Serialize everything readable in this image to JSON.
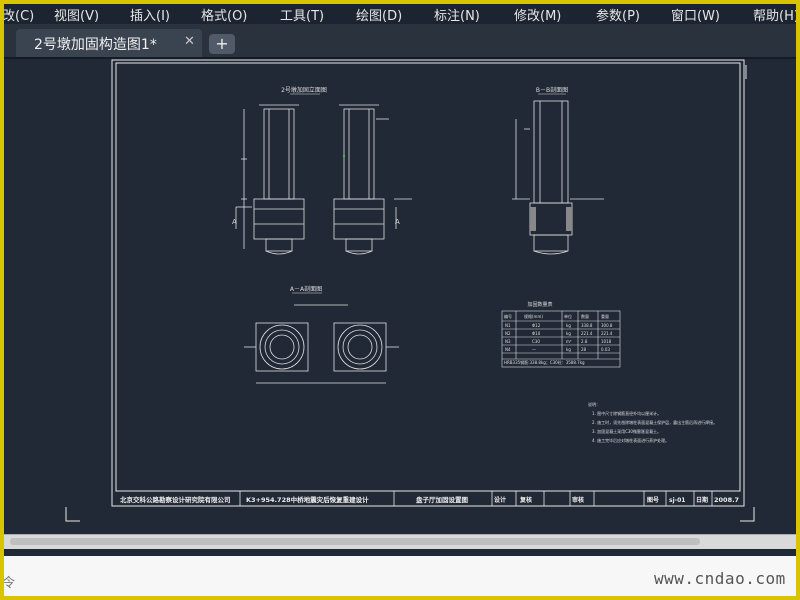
{
  "menu": [
    {
      "label": "改(C)"
    },
    {
      "label": "视图(V)"
    },
    {
      "label": "插入(I)"
    },
    {
      "label": "格式(O)"
    },
    {
      "label": "工具(T)"
    },
    {
      "label": "绘图(D)"
    },
    {
      "label": "标注(N)"
    },
    {
      "label": "修改(M)"
    },
    {
      "label": "参数(P)"
    },
    {
      "label": "窗口(W)"
    },
    {
      "label": "帮助(H)"
    }
  ],
  "tab": {
    "title": "2号墩加固构造图1*",
    "close": "✕",
    "add": "+"
  },
  "drawing": {
    "elevation_title": "2号墩加固立面图",
    "section_bb_title": "B－B剖面图",
    "section_aa_title": "A－A剖面图",
    "section_marker_a": "A",
    "section_marker_b": "B",
    "table_title": "加固数量表",
    "table_headers": [
      "编号",
      "规格(mm)",
      "单位",
      "数量",
      "重量"
    ],
    "table_rows": [
      [
        "N1",
        "Φ12",
        "kg",
        "338.8",
        "300.8"
      ],
      [
        "N2",
        "Φ10",
        "kg",
        "221.4",
        "221.4"
      ],
      [
        "N3",
        "C30",
        "m³",
        "2.8",
        "1018"
      ],
      [
        "N4",
        "—",
        "kg",
        "28",
        "0.03"
      ]
    ],
    "table_footer": "HRB335钢筋:338.8kg；C30砼：3588.7kg",
    "notes_title": "说明：",
    "notes": [
      "1. 图中尺寸除钢筋直径外均以厘米计。",
      "2. 施工时，须先凿除墩柱表面混凝土保护层，露出主筋后再进行焊接。",
      "3. 加固混凝土采用C30微膨胀混凝土。",
      "4. 施工完毕后应对墩柱表面进行养护处理。"
    ],
    "titleblock": {
      "company": "北京交科公路勘察设计研究院有限公司",
      "project": "K3+954.728中桥地震灾后恢复重建设计",
      "drawing_name": "盘子厅加固设置图",
      "design": "设计",
      "review": "复核",
      "approve": "审核",
      "sheet_label": "图号",
      "sheet_no": "sj-01",
      "date_label": "日期",
      "date": "2008.7"
    }
  },
  "command": {
    "text": "令"
  },
  "watermark": "www.cndao.com",
  "colors": {
    "canvas": "#212936",
    "frame": "#ffffff",
    "border": "#d8c400"
  }
}
